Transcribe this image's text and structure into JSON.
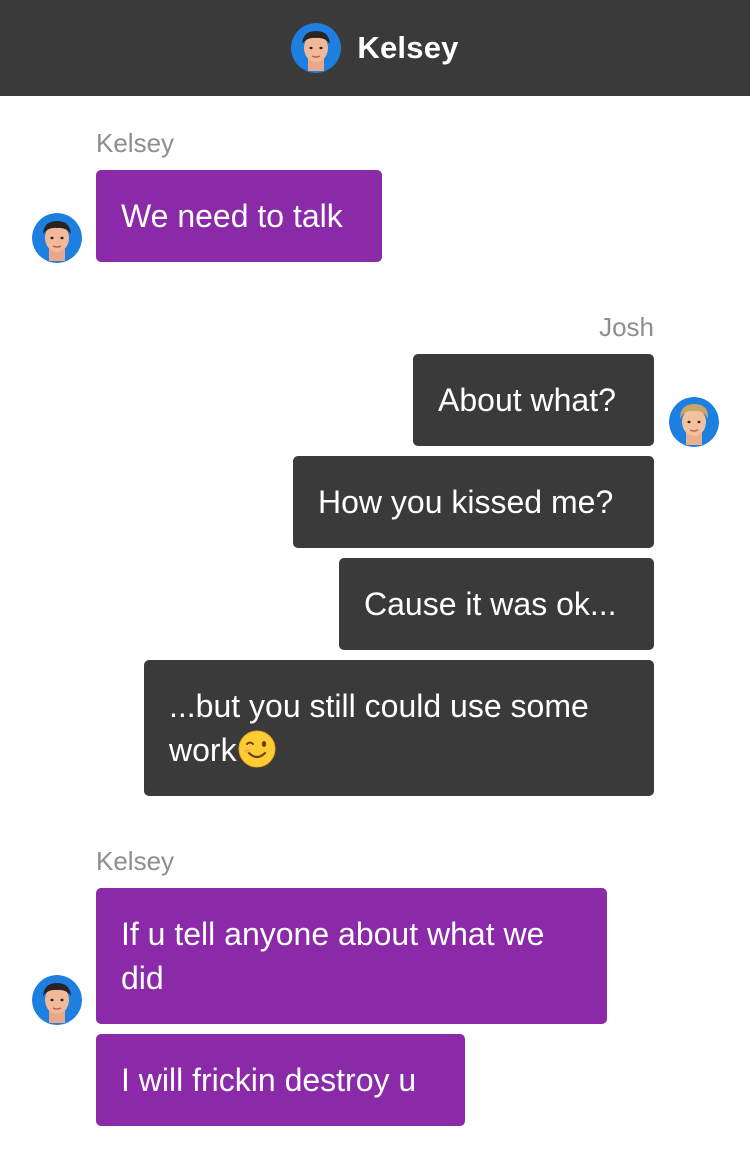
{
  "header": {
    "title": "Kelsey",
    "avatar_icon": "kelsey-avatar"
  },
  "colors": {
    "kelsey_bubble": "#8a2aa8",
    "josh_bubble": "#3a3a3a",
    "header_bg": "#3a3a3a",
    "sender_text": "#8e8e8e"
  },
  "groups": [
    {
      "sender": "Kelsey",
      "messages": [
        "We need to talk"
      ]
    },
    {
      "sender": "Josh",
      "messages": [
        "About what?",
        "How you kissed me?",
        "Cause it was ok...",
        "...but you still could use some work"
      ],
      "last_emoji": "winking-face"
    },
    {
      "sender": "Kelsey",
      "messages": [
        "If u tell anyone about what we did",
        "I will frickin destroy u"
      ]
    }
  ]
}
